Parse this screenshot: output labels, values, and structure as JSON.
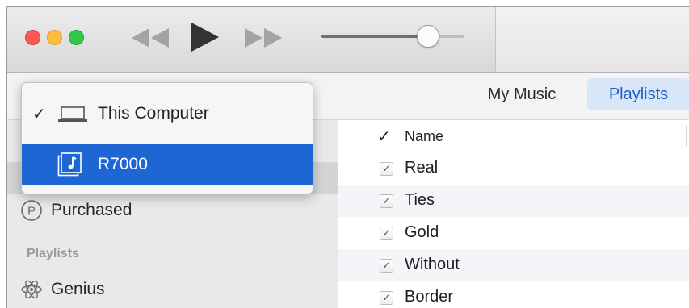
{
  "colors": {
    "accent": "#1e66d4",
    "close": "#fc5753",
    "minimize": "#fdbc40",
    "maximize": "#33c748",
    "tab_selected_bg": "#d8e6f8"
  },
  "toolbar": {
    "icons": {
      "rewind": "rewind-icon",
      "play": "play-icon",
      "fast_forward": "fast-forward-icon"
    },
    "volume_level": 0.75
  },
  "nav": {
    "tabs": [
      {
        "label": "My Music",
        "selected": false
      },
      {
        "label": "Playlists",
        "selected": true
      }
    ]
  },
  "device_menu": {
    "items": [
      {
        "label": "This Computer",
        "checked": true,
        "icon": "laptop-icon",
        "highlighted": false
      },
      {
        "label": "R7000",
        "checked": false,
        "icon": "music-library-icon",
        "highlighted": true
      }
    ]
  },
  "sidebar": {
    "items": [
      {
        "label": "Purchased",
        "icon": "purchased-icon"
      }
    ],
    "section_title": "Playlists",
    "playlists": [
      {
        "label": "Genius",
        "icon": "genius-icon"
      }
    ]
  },
  "song_list": {
    "header_check": "✓",
    "header_name": "Name",
    "songs": [
      {
        "name": "Real",
        "checked": true
      },
      {
        "name": "Ties",
        "checked": true
      },
      {
        "name": "Gold",
        "checked": true
      },
      {
        "name": "Without",
        "checked": true
      },
      {
        "name": "Border",
        "checked": true
      }
    ]
  }
}
